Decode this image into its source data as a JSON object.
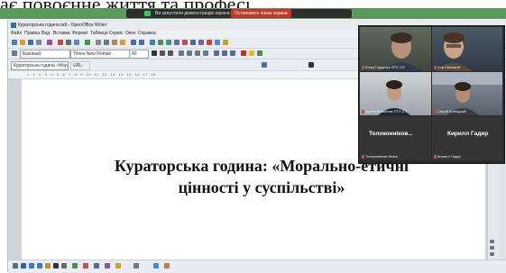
{
  "top_caption": "ає повоєнне життя та професі",
  "share_bar": {
    "message": "Ви запустили демонстрацію екрана",
    "stop_label": "Остановить показ экрана"
  },
  "writer": {
    "title": "Кураторська година.odt - OpenOffice Writer",
    "menu": [
      "Файл",
      "Правка",
      "Вид",
      "Вставка",
      "Формат",
      "Таблиця",
      "Сервіс",
      "Окно",
      "Справка"
    ],
    "style_box": "Базовый",
    "font_box": "Times New Roman",
    "size_box": "40",
    "search_box": "Кураторська година «Морально-етич...»",
    "url_box": "URL:",
    "ruler": "1 · 1 · 2 · 3 · 4 · 5 · 6 · 7 · 8 · 9 · 10 · 11 · 12 · 13 · 14 · 15 · 16 · 17 · 18",
    "heading_line1": "Кураторська година: «Морально-етичні",
    "heading_line2": "цінності у суспільстві»"
  },
  "video": {
    "tiles": [
      {
        "label": "Влад Тодарчук ПТЛ 2-Е"
      },
      {
        "label": "Ігор Сміський"
      },
      {
        "label": "Артем Налисник ПТЛ 2-Т"
      },
      {
        "label": "Сергій Білецький"
      }
    ],
    "names": [
      {
        "display": "Толоконніков...",
        "label": "Толоконніков Нікіта"
      },
      {
        "display": "Кирилл Гадир",
        "label": "Кирилл Гадир"
      }
    ]
  }
}
